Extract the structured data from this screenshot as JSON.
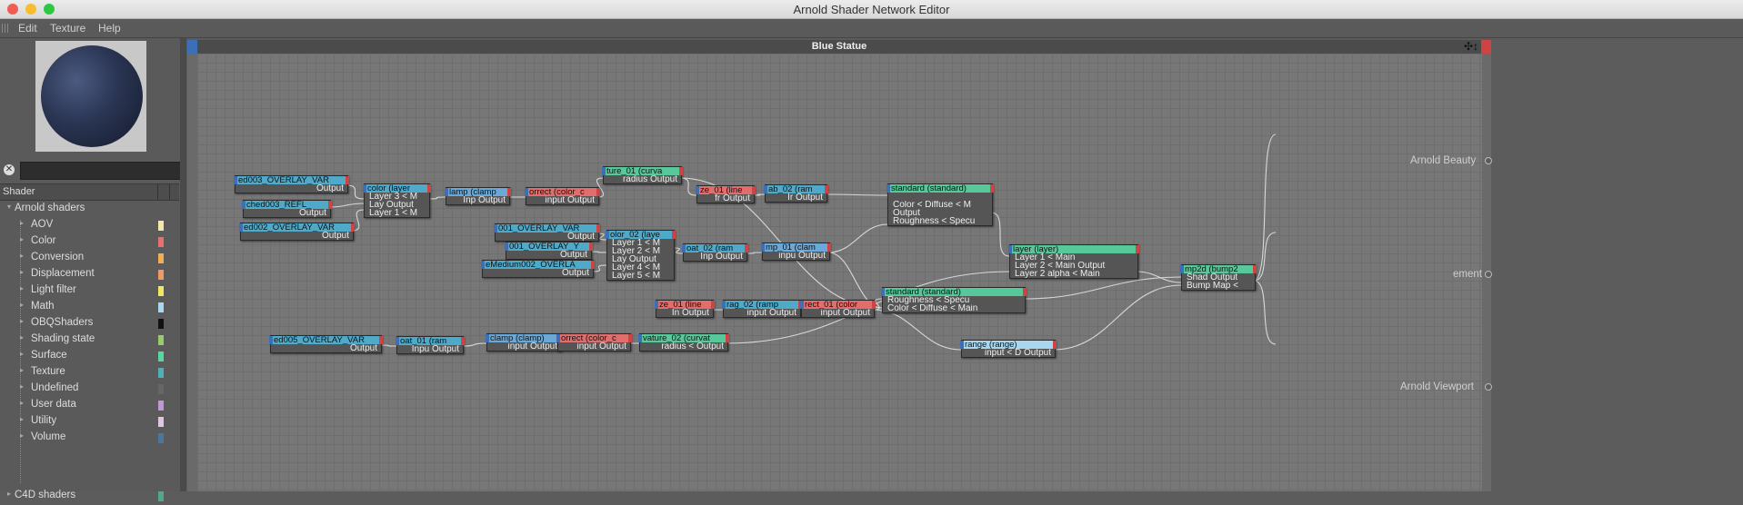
{
  "window": {
    "title": "Arnold Shader Network Editor"
  },
  "menu": [
    "Edit",
    "Texture",
    "Help"
  ],
  "sidebar": {
    "search_value": "",
    "column_header": "Shader",
    "tree": [
      {
        "label": "Arnold shaders",
        "level": 0,
        "swatch": ""
      },
      {
        "label": "AOV",
        "level": 1,
        "swatch": "#f2e8a8"
      },
      {
        "label": "Color",
        "level": 1,
        "swatch": "#e87070"
      },
      {
        "label": "Conversion",
        "level": 1,
        "swatch": "#f0b050"
      },
      {
        "label": "Displacement",
        "level": 1,
        "swatch": "#f09868"
      },
      {
        "label": "Light filter",
        "level": 1,
        "swatch": "#f0e860"
      },
      {
        "label": "Math",
        "level": 1,
        "swatch": "#a8d8f0"
      },
      {
        "label": "OBQShaders",
        "level": 1,
        "swatch": "#111111"
      },
      {
        "label": "Shading state",
        "level": 1,
        "swatch": "#98cc68"
      },
      {
        "label": "Surface",
        "level": 1,
        "swatch": "#58d8a0"
      },
      {
        "label": "Texture",
        "level": 1,
        "swatch": "#50b0b8"
      },
      {
        "label": "Undefined",
        "level": 1,
        "swatch": "#666666"
      },
      {
        "label": "User data",
        "level": 1,
        "swatch": "#c098d8"
      },
      {
        "label": "Utility",
        "level": 1,
        "swatch": "#e0c8e0"
      },
      {
        "label": "Volume",
        "level": 1,
        "swatch": "#4878a0"
      },
      {
        "label": "C4D shaders",
        "level": 0,
        "swatch": "#50a890"
      }
    ]
  },
  "canvas": {
    "title": "Blue Statue",
    "tool_icons": "✣↕"
  },
  "outputs": {
    "beauty": "Arnold Beauty",
    "displacement": "ement",
    "viewport": "Arnold Viewport"
  },
  "nodes": [
    {
      "id": "ov003",
      "title": "ed003_OVERLAY_VAR",
      "color": "#4fa9c9",
      "ports": [
        "Output"
      ]
    },
    {
      "id": "checker",
      "title": "ched003_REFL_",
      "color": "#4fa9c9",
      "ports": [
        "Output"
      ]
    },
    {
      "id": "ov002",
      "title": "ed002_OVERLAY_VAR",
      "color": "#4fa9c9",
      "ports": [
        "Output"
      ]
    },
    {
      "id": "color_layer",
      "title": "color (layer",
      "color": "#4fa9c9",
      "ports": [
        "Layer 3 < M",
        "Lay Output",
        "Layer 1 < M"
      ]
    },
    {
      "id": "clamp1",
      "title": "lamp (clamp",
      "color": "#6aa8d8",
      "ports": [
        "Inp Output"
      ]
    },
    {
      "id": "correct1",
      "title": "orrect (color_c",
      "color": "#e26d6d",
      "ports": [
        "input Output"
      ]
    },
    {
      "id": "curve01",
      "title": "ture_01 (curva",
      "color": "#56c89a",
      "ports": [
        "radius Output"
      ]
    },
    {
      "id": "fresnel01",
      "title": "ze_01 (line",
      "color": "#e26d6d",
      "ports": [
        "fr Output"
      ]
    },
    {
      "id": "ramp02",
      "title": "ab_02 (ram",
      "color": "#4fa9c9",
      "ports": [
        "Ir Output"
      ]
    },
    {
      "id": "standard1",
      "title": "standard (standard)",
      "color": "#56c89a",
      "ports": [
        "",
        "Color < Diffuse < M",
        "Output",
        "Roughness < Specu"
      ]
    },
    {
      "id": "ov001",
      "title": "001_OVERLAY_VAR",
      "color": "#4fa9c9",
      "ports": [
        "Output"
      ]
    },
    {
      "id": "ov001b",
      "title": "001_OVERLAY_Y",
      "color": "#4fa9c9",
      "ports": [
        "Output"
      ]
    },
    {
      "id": "ovmedium",
      "title": "eMedium002_OVERLA",
      "color": "#4fa9c9",
      "ports": [
        "Output"
      ]
    },
    {
      "id": "color02",
      "title": "olor_02 (laye",
      "color": "#4fa9c9",
      "ports": [
        "Layer 1 < M",
        "Layer 2 < M",
        "Lay Output",
        "Layer 4 < M",
        "Layer 5 < M"
      ]
    },
    {
      "id": "float02",
      "title": "oat_02 (ram",
      "color": "#4fa9c9",
      "ports": [
        "Inp Output"
      ]
    },
    {
      "id": "ramp01",
      "title": "mp_01 (clam",
      "color": "#6aa8d8",
      "ports": [
        "inpu Output"
      ]
    },
    {
      "id": "layer_main",
      "title": "layer (layer)",
      "color": "#56c89a",
      "ports": [
        "Layer 1 < Main",
        "Layer 2 < Main   Output",
        "Layer 2 alpha < Main"
      ]
    },
    {
      "id": "bump2d",
      "title": "mp2d (bump2",
      "color": "#56c89a",
      "ports": [
        "Shad Output",
        "Bump Map <"
      ]
    },
    {
      "id": "fresnel01b",
      "title": "ze_01 (line",
      "color": "#e26d6d",
      "ports": [
        "In Output"
      ]
    },
    {
      "id": "range02",
      "title": "rag_02 (ramp",
      "color": "#4fa9c9",
      "ports": [
        "input   Output"
      ]
    },
    {
      "id": "rect01",
      "title": "rect_01 (color",
      "color": "#e26d6d",
      "ports": [
        "input Output"
      ]
    },
    {
      "id": "standard2",
      "title": "standard (standard)",
      "color": "#56c89a",
      "ports": [
        "Roughness < Specu",
        "Color < Diffuse < Main"
      ]
    },
    {
      "id": "range",
      "title": "range (range)",
      "color": "#a8d8f0",
      "ports": [
        "input < D Output"
      ]
    },
    {
      "id": "ov005",
      "title": "ed005_OVERLAY_VAR",
      "color": "#4fa9c9",
      "ports": [
        "Output"
      ]
    },
    {
      "id": "ramp01b",
      "title": "oat_01 (ram",
      "color": "#4fa9c9",
      "ports": [
        "Inpu Output"
      ]
    },
    {
      "id": "clamp2",
      "title": "clamp (clamp)",
      "color": "#6aa8d8",
      "ports": [
        "input Output"
      ]
    },
    {
      "id": "correct2",
      "title": "orrect (color_c",
      "color": "#e26d6d",
      "ports": [
        "input Output"
      ]
    },
    {
      "id": "curve02",
      "title": "vature_02 (curvat",
      "color": "#56c89a",
      "ports": [
        "radius < Output"
      ]
    }
  ]
}
